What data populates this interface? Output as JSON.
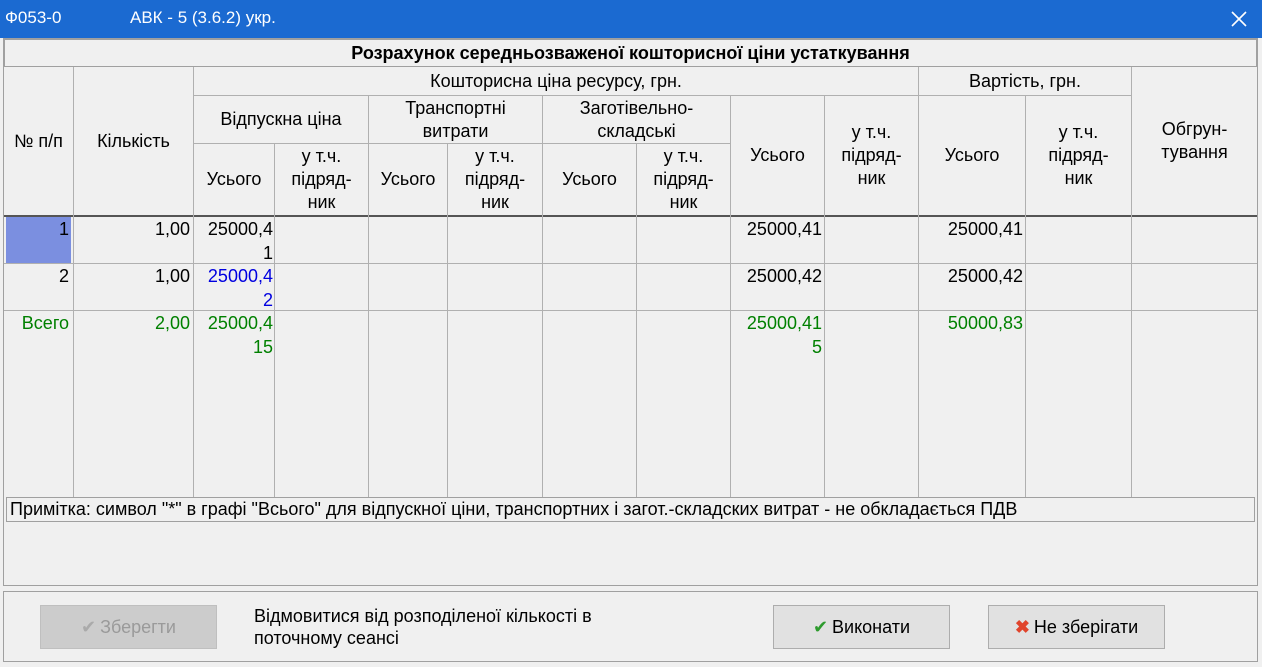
{
  "window": {
    "form_code": "Ф053-0",
    "app_title": "АВК - 5 (3.6.2) укр.",
    "close_icon": "close-icon"
  },
  "table": {
    "title": "Розрахунок середньозваженої кошторисної ціни устаткування",
    "headers": {
      "num": "№ п/п",
      "qty": "Кількість",
      "estimate_price": "Кошторисна ціна ресурсу, грн.",
      "release_price": "Відпускна ціна",
      "transport": "Транспортні витрати",
      "procurement": "Заготівельно-складські",
      "total": "Усього",
      "incl_contractor": "у т.ч. підряд-ник",
      "cost": "Вартість, грн.",
      "justification": "Обгрун-тування"
    },
    "rows": [
      {
        "num": "1",
        "qty": "1,00",
        "release_total": "25000,41",
        "total": "25000,41",
        "cost_total": "25000,41"
      },
      {
        "num": "2",
        "qty": "1,00",
        "release_total": "25000,42",
        "total": "25000,42",
        "cost_total": "25000,42"
      }
    ],
    "summary": {
      "label": "Всего",
      "qty": "2,00",
      "release_total": "25000,415",
      "total": "25000,415",
      "cost_total": "50000,83"
    }
  },
  "note": "Примітка: символ \"*\" в графі \"Всього\" для відпускної ціни, транспортних і загот.-складских витрат - не обкладається ПДВ",
  "footer": {
    "save_label": "Зберегти",
    "message": "Відмовитися від розподіленої кількості в поточному сеансі",
    "execute_label": "Виконати",
    "dont_save_label": "Не зберігати"
  },
  "colors": {
    "titlebar": "#1b6ad1",
    "selected_cell": "#7b8fe0",
    "edited_value": "#0000e0",
    "summary_text": "#008000",
    "check_green": "#2e9b2e",
    "cross_red": "#e0442c"
  }
}
